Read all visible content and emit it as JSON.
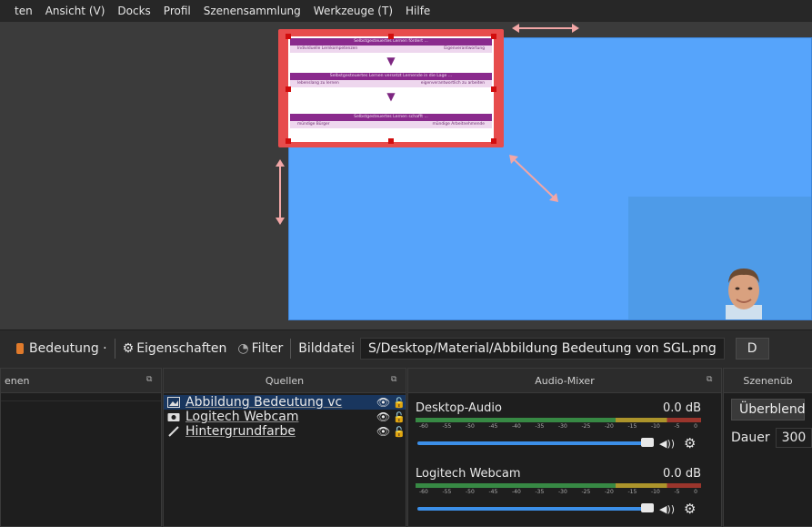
{
  "menu": [
    "ten",
    "Ansicht (V)",
    "Docks",
    "Profil",
    "Szenensammlung",
    "Werkzeuge (T)",
    "Hilfe"
  ],
  "diagram": {
    "row1_header": "Selbstgesteuertes Lernen fördert ...",
    "row1_left": "Individuelle Lernkompetenzen",
    "row1_right": "Eigenverantwortung",
    "row2_header": "Selbstgesteuertes Lernen versetzt Lernende in die Lage ...",
    "row2_left": "lebenslang zu lernen",
    "row2_right": "eigenverantwortlich zu arbeiten",
    "row3_header": "Selbstgesteuertes Lernen schafft ...",
    "row3_left": "mündige Bürger",
    "row3_right": "mündige Arbeitnehmende",
    "arrow": "▼"
  },
  "toolbar": {
    "source_label": "Bedeutung ·",
    "properties": "Eigenschaften",
    "filter": "Filter",
    "image_file_label": "Bilddatei",
    "image_file_path": "S/Desktop/Material/Abbildung Bedeutung von SGL.png",
    "browse": "D"
  },
  "docks": {
    "scenes_title": "enen",
    "sources_title": "Quellen",
    "mixer_title": "Audio-Mixer",
    "transitions_title": "Szenenüb",
    "float_icon": "⧉"
  },
  "sources": [
    {
      "name": "Abbildung Bedeutung vc",
      "icon": "image-icon",
      "visible": true,
      "locked": false
    },
    {
      "name": "Logitech Webcam",
      "icon": "camera-icon",
      "visible": true,
      "locked": false
    },
    {
      "name": "Hintergrundfarbe",
      "icon": "brush-icon",
      "visible": true,
      "locked": false
    }
  ],
  "source_glyphs": {
    "eye": "👁",
    "lock": "🔓"
  },
  "mixer": [
    {
      "name": "Desktop-Audio",
      "level": "0.0 dB",
      "volume": 1.0
    },
    {
      "name": "Logitech Webcam",
      "level": "0.0 dB",
      "volume": 1.0
    }
  ],
  "meter_ticks": [
    "-60",
    "-55",
    "-50",
    "-45",
    "-40",
    "-35",
    "-30",
    "-25",
    "-20",
    "-15",
    "-10",
    "-5",
    "0"
  ],
  "mixer_glyphs": {
    "speaker": "◀))",
    "gear": "⚙"
  },
  "transitions": {
    "select_value": "Überblend",
    "duration_label": "Dauer",
    "duration_value": "300"
  },
  "colors": {
    "canvas": "#56a4fb",
    "selection": "#e74c4c",
    "diagram_purple": "#8a2a8d",
    "accent_blue": "#3c8fe8"
  }
}
